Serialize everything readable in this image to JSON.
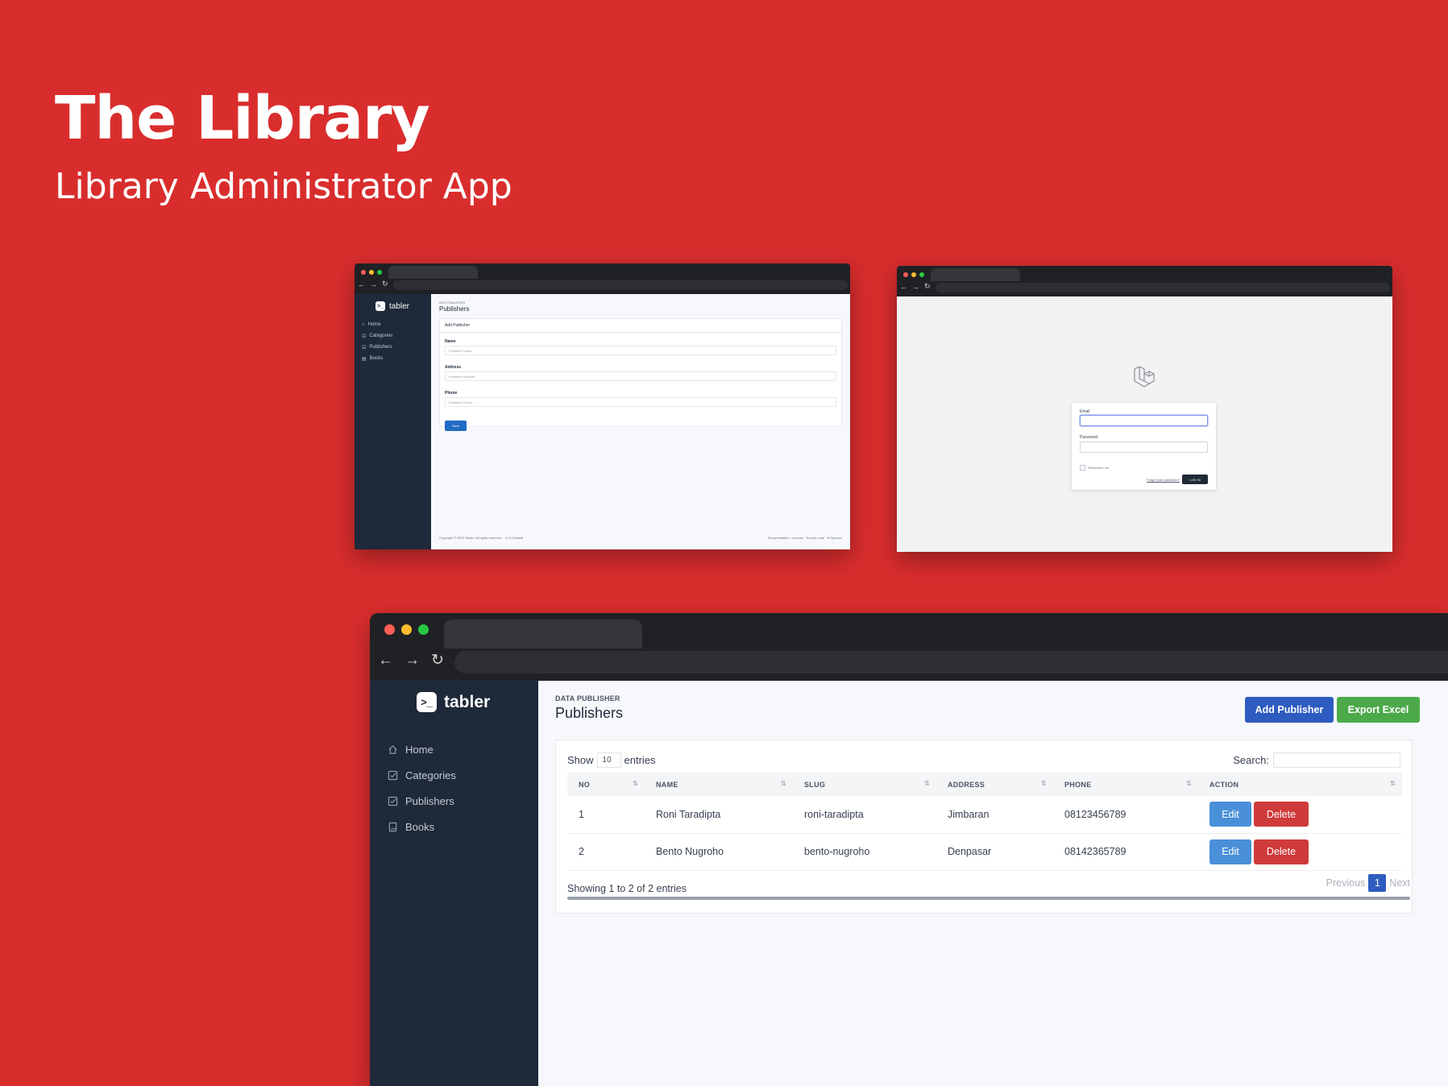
{
  "hero": {
    "title": "The Library",
    "subtitle": "Library Administrator App"
  },
  "colors": {
    "background": "#d92d2d",
    "sidebar": "#1e2939",
    "primary": "#2e5bbf",
    "success": "#4ca94a",
    "danger": "#cf3a3a",
    "edit": "#4a90d9",
    "traffic": [
      "#ff5f57",
      "#febc2e",
      "#28c840"
    ]
  },
  "add_publisher_window": {
    "brand": "tabler",
    "menu": [
      "Home",
      "Categories",
      "Publishers",
      "Books"
    ],
    "pretitle": "ADD PUBLISHER",
    "title": "Publishers",
    "card_title": "Add Publisher",
    "fields": [
      {
        "label": "Name",
        "placeholder": "Publisher Name"
      },
      {
        "label": "Address",
        "placeholder": "Publisher Address"
      },
      {
        "label": "Phone",
        "placeholder": "Publisher Phone"
      }
    ],
    "save_label": "Save",
    "footer_left": "Copyright © 2022 Tabler. All rights reserved.   ·   v1.0.0-beta8",
    "footer_right": "Documentation  ·  License  ·  Source code  ·  ♥ Sponsor"
  },
  "login_window": {
    "email_label": "Email",
    "password_label": "Password",
    "remember_label": "Remember me",
    "forgot_label": "Forgot your password?",
    "login_button": "LOG IN"
  },
  "publishers_window": {
    "brand": "tabler",
    "menu": [
      "Home",
      "Categories",
      "Publishers",
      "Books"
    ],
    "pretitle": "DATA PUBLISHER",
    "title": "Publishers",
    "add_button": "Add Publisher",
    "export_button": "Export Excel",
    "show_label": "Show",
    "show_value": "10",
    "entries_label": "entries",
    "search_label": "Search:",
    "columns": [
      "NO",
      "NAME",
      "SLUG",
      "ADDRESS",
      "PHONE",
      "ACTION"
    ],
    "rows": [
      {
        "no": "1",
        "name": "Roni Taradipta",
        "slug": "roni-taradipta",
        "address": "Jimbaran",
        "phone": "08123456789"
      },
      {
        "no": "2",
        "name": "Bento Nugroho",
        "slug": "bento-nugroho",
        "address": "Denpasar",
        "phone": "08142365789"
      }
    ],
    "edit_label": "Edit",
    "delete_label": "Delete",
    "info": "Showing 1 to 2 of 2 entries",
    "prev_label": "Previous",
    "page": "1",
    "next_label": "Next"
  }
}
